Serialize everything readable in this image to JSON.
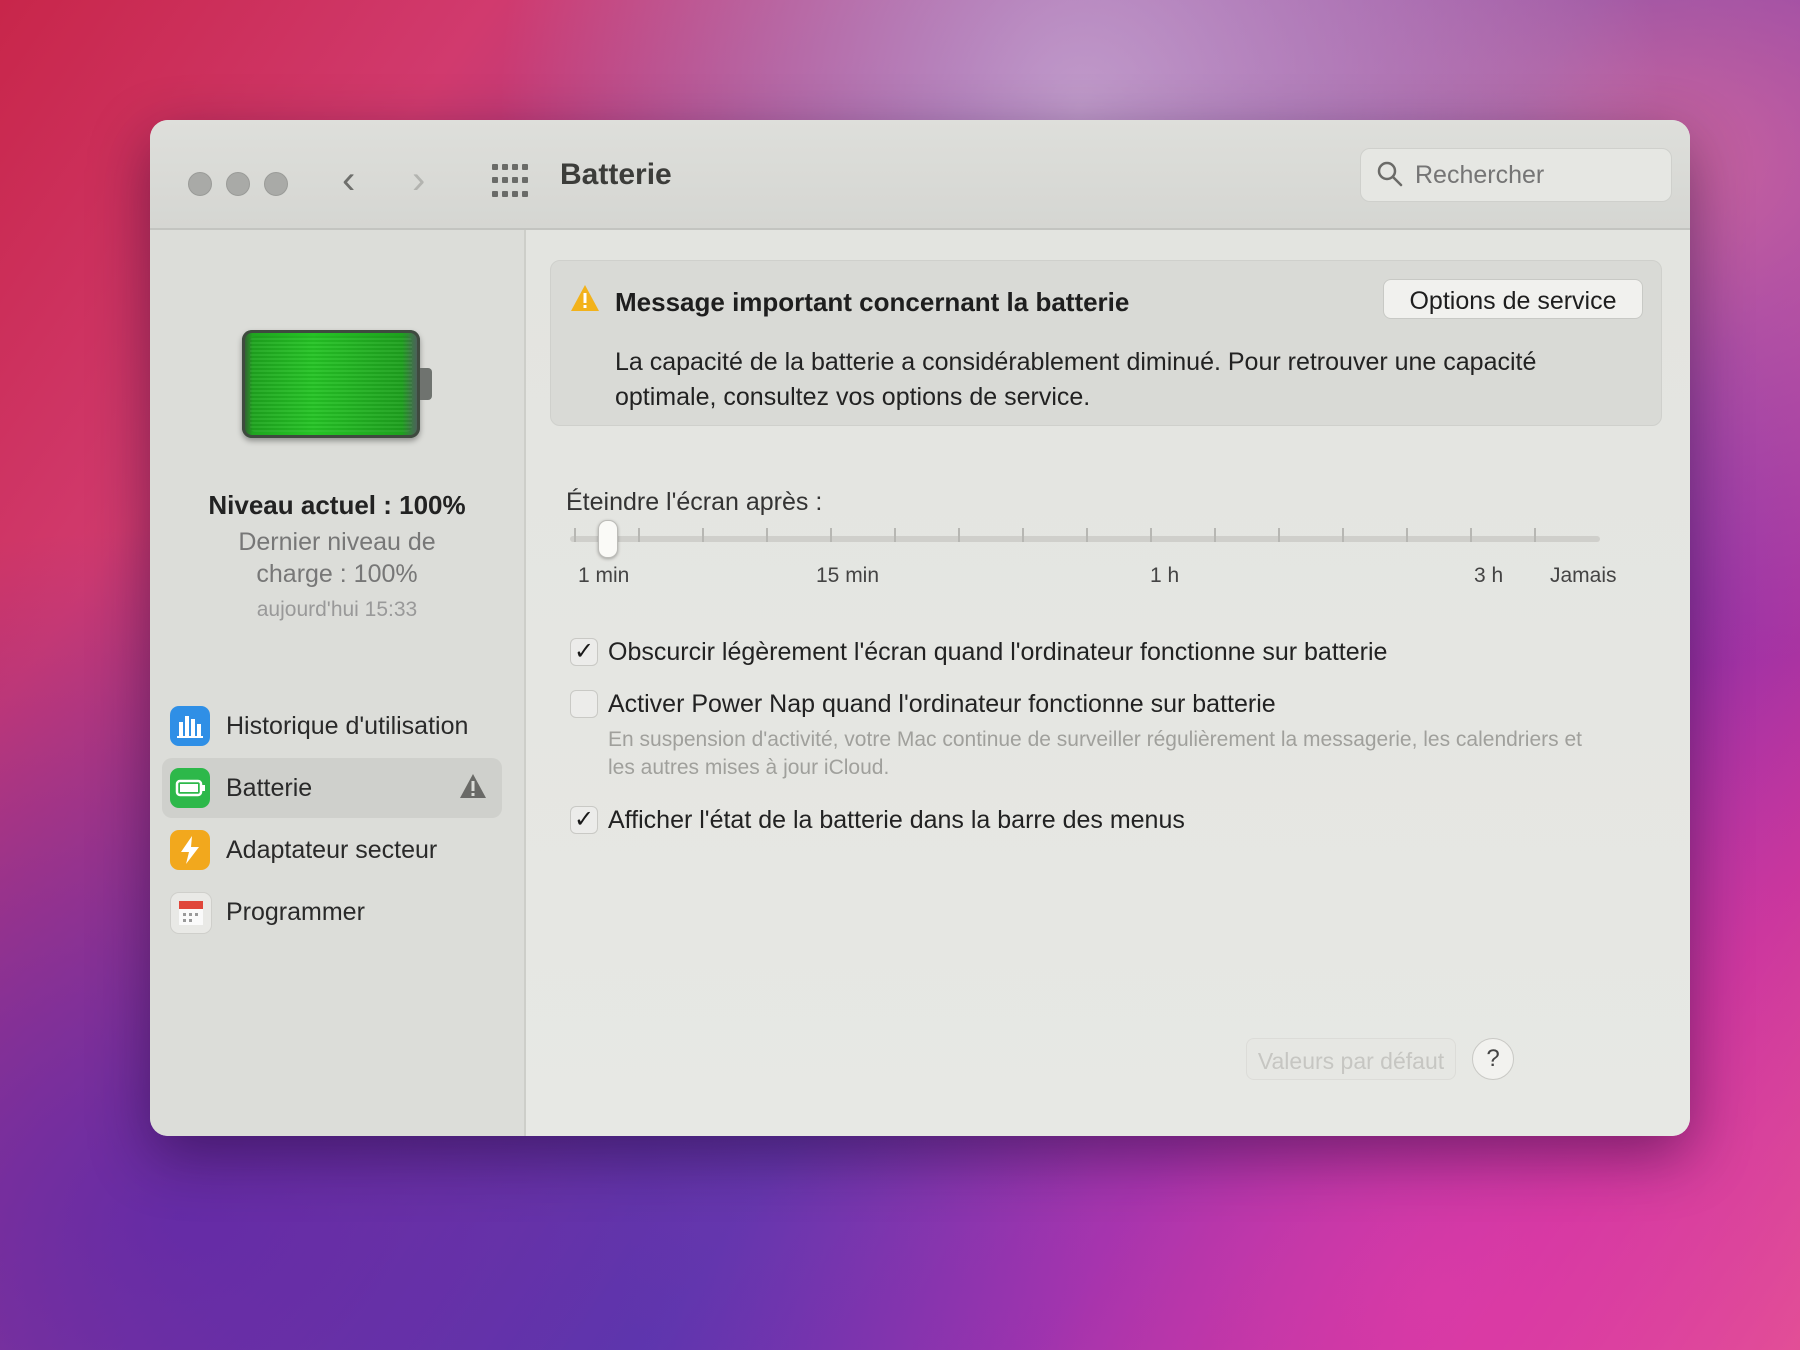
{
  "window": {
    "title": "Batterie",
    "search_placeholder": "Rechercher"
  },
  "sidebar": {
    "level_current": "Niveau actuel : 100%",
    "level_last": "Dernier niveau de charge : 100%",
    "level_time": "aujourd'hui 15:33",
    "battery_level_fraction": 1.0,
    "items": [
      {
        "label": "Historique d'utilisation",
        "icon": "bar-chart-icon",
        "color": "#2f8fe6"
      },
      {
        "label": "Batterie",
        "icon": "battery-icon",
        "color": "#2db84a",
        "selected": true,
        "warning": true
      },
      {
        "label": "Adaptateur secteur",
        "icon": "lightning-icon",
        "color": "#f2a81d"
      },
      {
        "label": "Programmer",
        "icon": "calendar-icon",
        "color": "#e0463a"
      }
    ]
  },
  "alert": {
    "title": "Message important concernant la batterie",
    "button": "Options de service",
    "body": "La capacité de la batterie a considérablement diminué. Pour retrouver une capacité optimale, consultez vos options de service."
  },
  "display_sleep": {
    "label": "Éteindre l'écran après :",
    "ticks": [
      "1 min",
      "15 min",
      "1 h",
      "3 h",
      "Jamais"
    ],
    "value": "1 min"
  },
  "options": [
    {
      "label": "Obscurcir légèrement l'écran quand l'ordinateur fonctionne sur batterie",
      "checked": true,
      "enabled": true
    },
    {
      "label": "Activer Power Nap quand l'ordinateur fonctionne sur batterie",
      "checked": false,
      "enabled": true,
      "description": "En suspension d'activité, votre Mac continue de surveiller régulièrement la messagerie, les calendriers et les autres mises à jour iCloud."
    },
    {
      "label": "Afficher l'état de la batterie dans la barre des menus",
      "checked": true,
      "enabled": true
    }
  ],
  "footer": {
    "defaults_button": "Valeurs par défaut",
    "help_button": "?"
  },
  "colors": {
    "warning": "#f2b21b",
    "battery_fill": "#25c425"
  }
}
